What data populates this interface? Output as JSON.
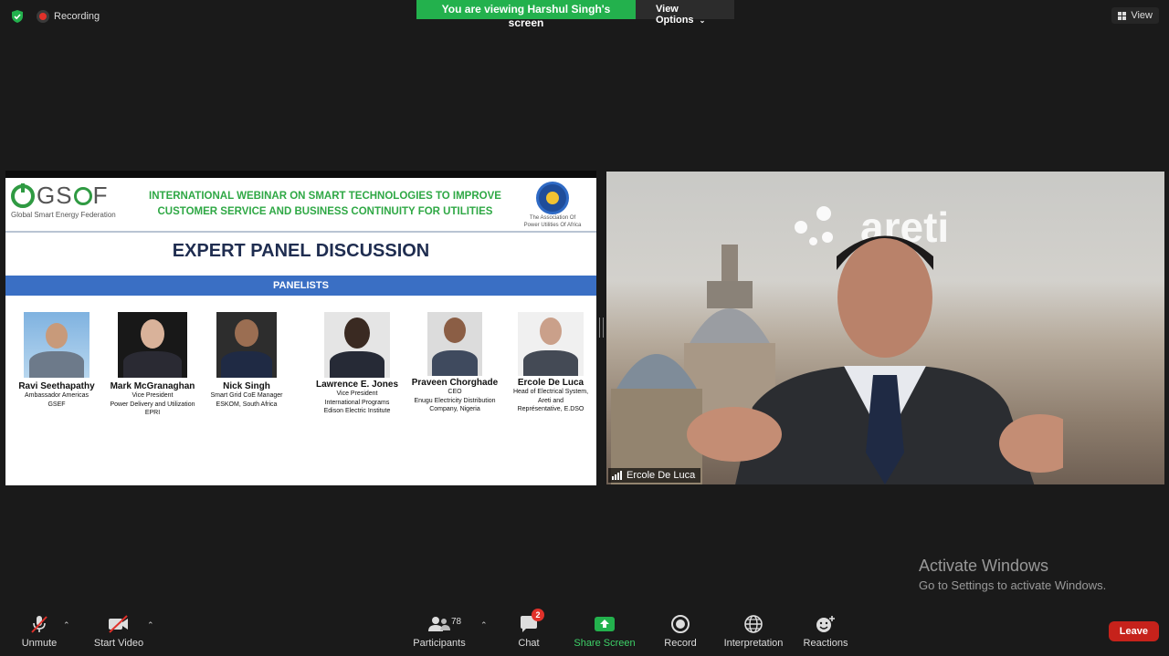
{
  "top": {
    "recording": "Recording",
    "viewing_banner": "You are viewing Harshul Singh's screen",
    "view_options": "View Options",
    "view_button": "View"
  },
  "slide": {
    "logo_text": "GS",
    "logo_text2": "F",
    "logo_sub": "Global Smart Energy Federation",
    "headline_1": "INTERNATIONAL WEBINAR ON SMART TECHNOLOGIES TO IMPROVE",
    "headline_2": "CUSTOMER SERVICE AND BUSINESS CONTINUITY FOR UTILITIES",
    "apua_line1": "The Association Of",
    "apua_line2": "Power Utilities Of Africa",
    "title": "EXPERT PANEL DISCUSSION",
    "band": "PANELISTS",
    "panelists": [
      {
        "name": "Ravi Seethapathy",
        "role1": "Ambassador  Americas",
        "role2": "GSEF",
        "role3": ""
      },
      {
        "name": "Mark McGranaghan",
        "role1": "Vice President",
        "role2": "Power Delivery and Utilization",
        "role3": "EPRI"
      },
      {
        "name": "Nick Singh",
        "role1": "Smart Grid CoE Manager",
        "role2": "ESKOM, South Africa",
        "role3": ""
      },
      {
        "name": "Lawrence E. Jones",
        "role1": "Vice President",
        "role2": "International Programs",
        "role3": "Edison Electric Institute"
      },
      {
        "name": "Praveen Chorghade",
        "role1": "CEO",
        "role2": "Enugu Electricity Distribution",
        "role3": "Company, Nigeria"
      },
      {
        "name": "Ercole De Luca",
        "role1": "Head of Electrical System,",
        "role2": "Areti and",
        "role3": "Représentative, E.DSO"
      }
    ]
  },
  "video": {
    "brand": "areti",
    "participant_name": "Ercole De Luca"
  },
  "watermark": {
    "line1": "Activate Windows",
    "line2": "Go to Settings to activate Windows."
  },
  "toolbar": {
    "unmute": "Unmute",
    "start_video": "Start Video",
    "participants": "Participants",
    "participant_count": "78",
    "chat": "Chat",
    "chat_badge": "2",
    "share": "Share Screen",
    "record": "Record",
    "interpretation": "Interpretation",
    "reactions": "Reactions",
    "leave": "Leave"
  },
  "colors": {
    "share_green": "#23b14d",
    "leave_red": "#c6221b",
    "headline_green": "#2fa845",
    "band_blue": "#3a6fc4"
  }
}
